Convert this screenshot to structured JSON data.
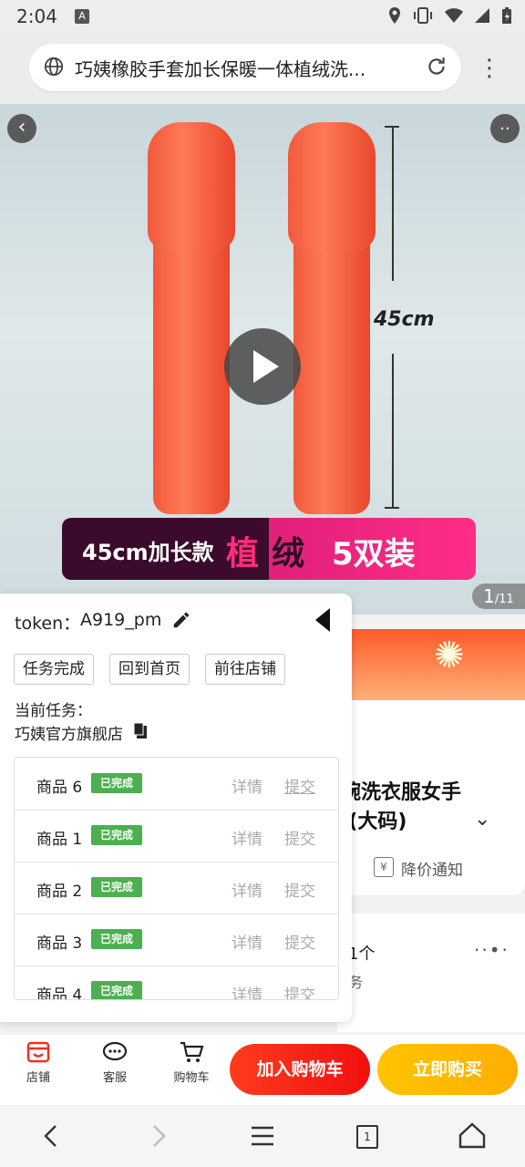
{
  "status_bar": {
    "time": "2:04",
    "a_icon": "A"
  },
  "browser": {
    "page_title": "巧姨橡胶手套加长保暖一体植绒洗碗洗衣服女手套(大码)",
    "page_title_display": "巧姨橡胶手套加长保暖一体植绒洗..."
  },
  "hero": {
    "measure": "45cm",
    "banner_part1": "45cm加长款",
    "banner_part2a": "植",
    "banner_part2b": "绒",
    "banner_part3": "5双装",
    "counter_current": "1",
    "counter_total": "/11"
  },
  "product": {
    "name_line1": "碗洗衣服女手",
    "name_line2": ".(大码)",
    "price_notify": "降价通知",
    "service_line1": "1个",
    "service_line2": "务"
  },
  "panel": {
    "token_label": "token：",
    "token_value": "A919_pm",
    "buttons": [
      "任务完成",
      "回到首页",
      "前往店铺"
    ],
    "current_task_label": "当前任务：",
    "current_store": "巧姨官方旗舰店",
    "items": [
      {
        "name": "商品 6",
        "status": "已完成",
        "detail": "详情",
        "submit": "提交"
      },
      {
        "name": "商品 1",
        "status": "已完成",
        "detail": "详情",
        "submit": "提交"
      },
      {
        "name": "商品 2",
        "status": "已完成",
        "detail": "详情",
        "submit": "提交"
      },
      {
        "name": "商品 3",
        "status": "已完成",
        "detail": "详情",
        "submit": "提交"
      },
      {
        "name": "商品 4",
        "status": "已完成",
        "detail": "详情",
        "submit": "提交"
      }
    ]
  },
  "action_bar": {
    "store": "店铺",
    "service": "客服",
    "cart": "购物车",
    "add_to_cart": "加入购物车",
    "buy_now": "立即购买"
  },
  "nav": {
    "tabs_count": "1"
  },
  "colors": {
    "accent_red": "#f00f0f",
    "accent_yellow": "#ffc400",
    "badge_green": "#4caf50"
  }
}
